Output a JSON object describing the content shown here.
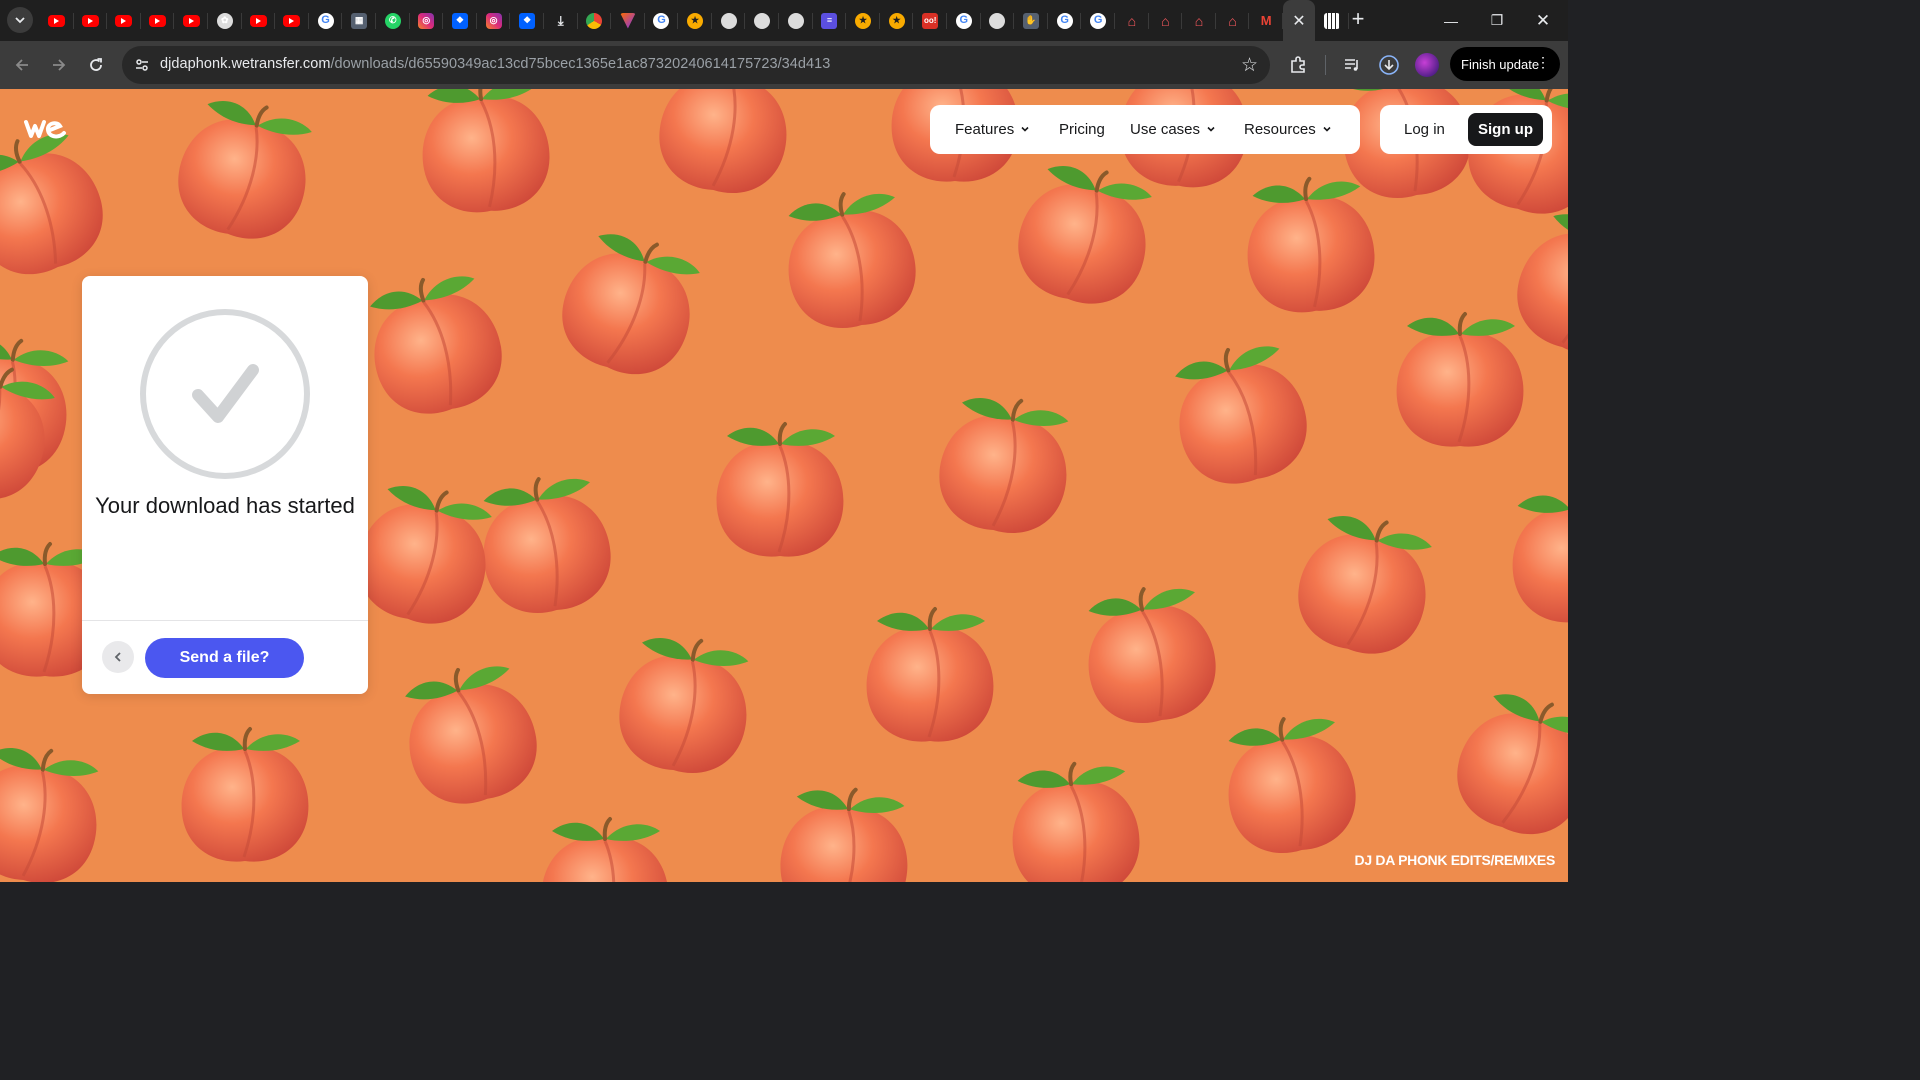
{
  "browser": {
    "tabs": [
      "youtube",
      "youtube",
      "youtube",
      "youtube",
      "youtube",
      "chatgpt",
      "youtube",
      "youtube",
      "google",
      "square",
      "whatsapp",
      "instagram",
      "dropbox",
      "instagram",
      "dropbox",
      "download",
      "chrome",
      "vee",
      "google",
      "star",
      "globe",
      "globe",
      "globe",
      "list",
      "star",
      "star",
      "oo",
      "google",
      "globe",
      "cc",
      "google",
      "google",
      "airbnb",
      "airbnb",
      "airbnb",
      "airbnb",
      "gmail"
    ],
    "active_tab_icon": "close-icon",
    "url_host": "djdaphonk.wetransfer.com",
    "url_path": "/downloads/d65590349ac13cd75bcec1365e1ac87320240614175723/34d413",
    "finish_update_label": "Finish update"
  },
  "site": {
    "logo_alt": "we",
    "nav": {
      "features": "Features",
      "pricing": "Pricing",
      "use_cases": "Use cases",
      "resources": "Resources"
    },
    "login": "Log in",
    "signup": "Sign up",
    "background_color": "#ee8c4d",
    "accent_color": "#4b57f0"
  },
  "card": {
    "title": "Your download has started",
    "send_button": "Send a file?"
  },
  "credit": "DJ DA PHONK EDITS/REMIXES"
}
